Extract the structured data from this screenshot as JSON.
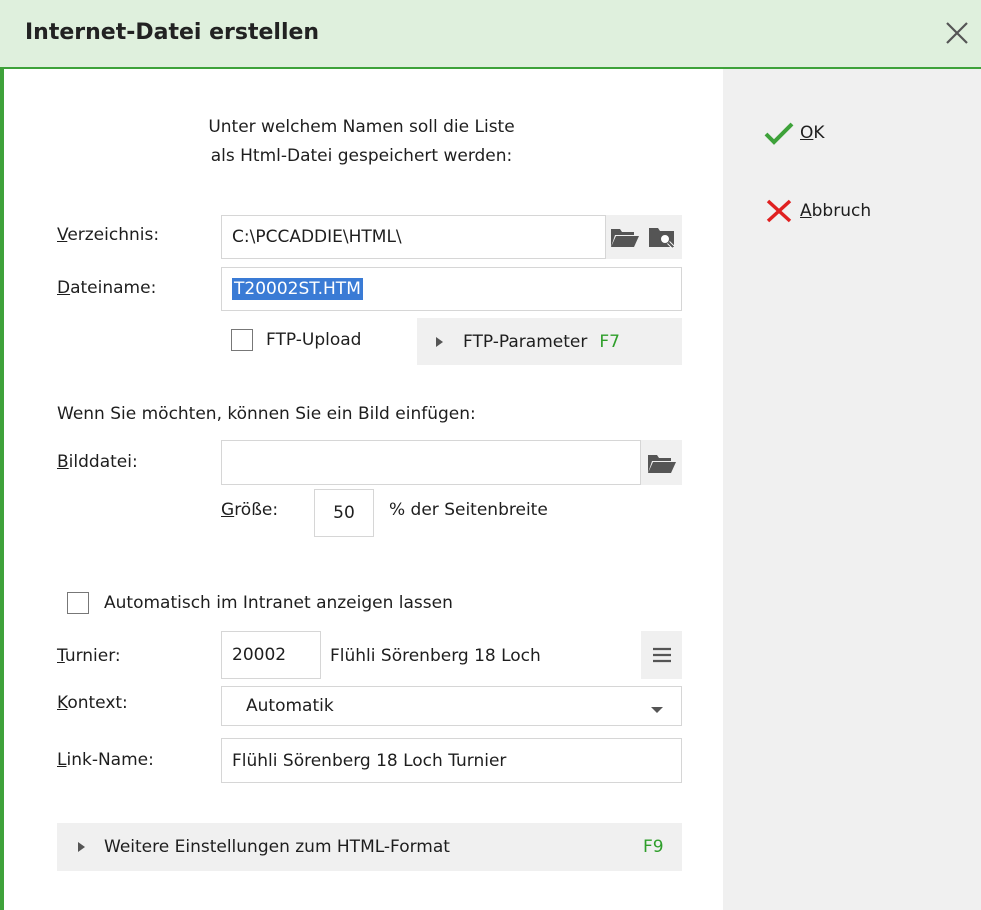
{
  "window": {
    "title": "Internet-Datei erstellen"
  },
  "prompt": {
    "line1": "Unter welchem Namen soll die Liste",
    "line2": "als Html-Datei gespeichert werden:"
  },
  "directory": {
    "label_u": "V",
    "label_rest": "erzeichnis:",
    "value": "C:\\PCCADDIE\\HTML\\"
  },
  "filename": {
    "label_u": "D",
    "label_rest": "ateiname:",
    "value": "T20002ST.HTM"
  },
  "ftp": {
    "upload_label": "FTP-Upload",
    "param_label": "FTP-Parameter",
    "param_key": "F7"
  },
  "image": {
    "intro": "Wenn Sie möchten, können Sie ein Bild einfügen:",
    "label_u": "B",
    "label_rest": "ilddatei:",
    "value": "",
    "size_label_u": "G",
    "size_label_rest": "röße:",
    "size_value": "50",
    "size_suffix": "% der Seitenbreite"
  },
  "intranet": {
    "auto_label": "Automatisch im Intranet anzeigen lassen"
  },
  "tournament": {
    "label_u": "T",
    "label_rest": "urnier:",
    "number": "20002",
    "name": "Flühli Sörenberg 18 Loch"
  },
  "context": {
    "label_u": "K",
    "label_rest": "ontext:",
    "value": "Automatik"
  },
  "linkname": {
    "label_u": "L",
    "label_rest": "ink-Name:",
    "value": "Flühli Sörenberg 18 Loch Turnier"
  },
  "more": {
    "label": "Weitere Einstellungen zum HTML-Format",
    "key": "F9"
  },
  "actions": {
    "ok_u": "O",
    "ok_rest": "K",
    "cancel_u": "A",
    "cancel_rest": "bbruch"
  },
  "colors": {
    "accent": "#3ea23a",
    "titlebar_bg": "#dff0dd",
    "panel_bg": "#f0f0f0",
    "cancel_red": "#e02020",
    "selection": "#3a7bd5"
  }
}
